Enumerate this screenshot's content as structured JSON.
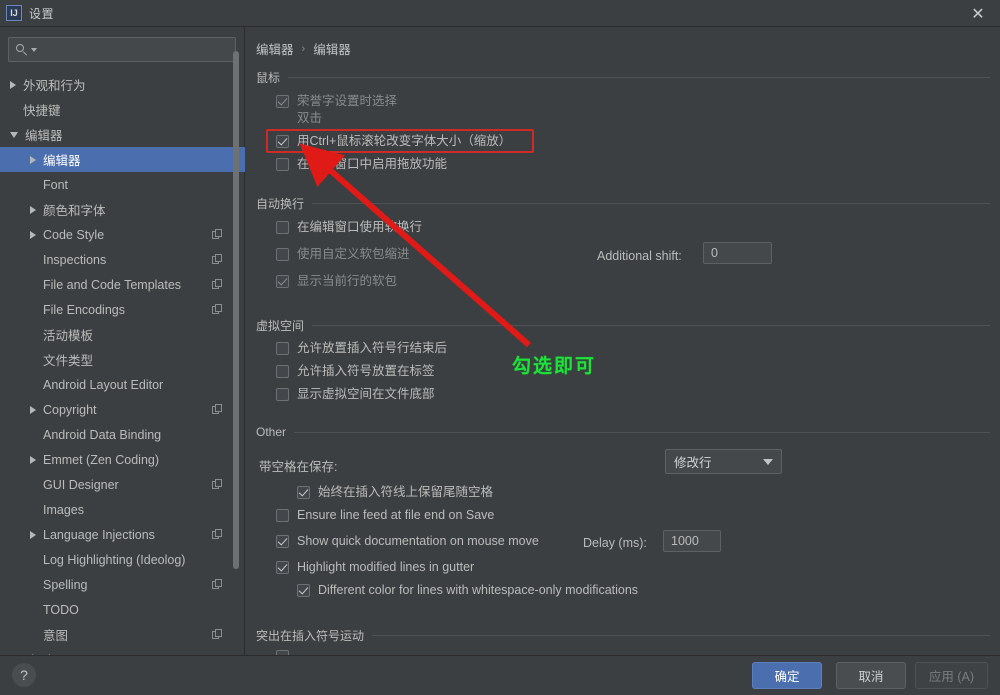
{
  "window": {
    "title": "设置",
    "app_icon": "intellij-idea-icon",
    "close_icon": "close-icon"
  },
  "sidebar": {
    "search": {
      "value": "",
      "placeholder": "",
      "icon": "search-icon",
      "caret_icon": "chevron-down-icon"
    },
    "items": [
      {
        "label": "外观和行为",
        "indent": 0,
        "arrow": "right",
        "badge": false,
        "selected": false
      },
      {
        "label": "快捷键",
        "indent": 0,
        "arrow": "none",
        "badge": false,
        "selected": false
      },
      {
        "label": "编辑器",
        "indent": 0,
        "arrow": "down",
        "badge": false,
        "selected": false
      },
      {
        "label": "编辑器",
        "indent": 1,
        "arrow": "right",
        "badge": false,
        "selected": true
      },
      {
        "label": "Font",
        "indent": 1,
        "arrow": "none",
        "badge": false,
        "selected": false
      },
      {
        "label": "颜色和字体",
        "indent": 1,
        "arrow": "right",
        "badge": false,
        "selected": false
      },
      {
        "label": "Code Style",
        "indent": 1,
        "arrow": "right",
        "badge": true,
        "selected": false
      },
      {
        "label": "Inspections",
        "indent": 1,
        "arrow": "none",
        "badge": true,
        "selected": false
      },
      {
        "label": "File and Code Templates",
        "indent": 1,
        "arrow": "none",
        "badge": true,
        "selected": false
      },
      {
        "label": "File Encodings",
        "indent": 1,
        "arrow": "none",
        "badge": true,
        "selected": false
      },
      {
        "label": "活动模板",
        "indent": 1,
        "arrow": "none",
        "badge": false,
        "selected": false
      },
      {
        "label": "文件类型",
        "indent": 1,
        "arrow": "none",
        "badge": false,
        "selected": false
      },
      {
        "label": "Android Layout Editor",
        "indent": 1,
        "arrow": "none",
        "badge": false,
        "selected": false
      },
      {
        "label": "Copyright",
        "indent": 1,
        "arrow": "right",
        "badge": true,
        "selected": false
      },
      {
        "label": "Android Data Binding",
        "indent": 1,
        "arrow": "none",
        "badge": false,
        "selected": false
      },
      {
        "label": "Emmet (Zen Coding)",
        "indent": 1,
        "arrow": "right",
        "badge": false,
        "selected": false
      },
      {
        "label": "GUI Designer",
        "indent": 1,
        "arrow": "none",
        "badge": true,
        "selected": false
      },
      {
        "label": "Images",
        "indent": 1,
        "arrow": "none",
        "badge": false,
        "selected": false
      },
      {
        "label": "Language Injections",
        "indent": 1,
        "arrow": "right",
        "badge": true,
        "selected": false
      },
      {
        "label": "Log Highlighting (Ideolog)",
        "indent": 1,
        "arrow": "none",
        "badge": false,
        "selected": false
      },
      {
        "label": "Spelling",
        "indent": 1,
        "arrow": "none",
        "badge": true,
        "selected": false
      },
      {
        "label": "TODO",
        "indent": 1,
        "arrow": "none",
        "badge": false,
        "selected": false
      },
      {
        "label": "意图",
        "indent": 1,
        "arrow": "none",
        "badge": true,
        "selected": false
      },
      {
        "label": "Plugins",
        "indent": 0,
        "arrow": "none",
        "badge": false,
        "selected": false
      }
    ]
  },
  "main": {
    "breadcrumb": {
      "root": "编辑器",
      "separator": "›",
      "leaf": "编辑器"
    },
    "groups": {
      "mouse": "鼠标",
      "wordwrap": "自动换行",
      "virtualspace": "虚拟空间",
      "other": "Other",
      "caret": "突出在插入符号运动"
    },
    "mouse_options": [
      {
        "label": "荣誉字设置时选择",
        "checked": true,
        "enabled": false
      },
      {
        "label": "双击",
        "checked": null,
        "enabled": false
      },
      {
        "label": "用Ctrl+鼠标滚轮改变字体大小（缩放）",
        "checked": true,
        "enabled": true
      },
      {
        "label": "在编辑窗口中启用拖放功能",
        "checked": false,
        "enabled": true
      }
    ],
    "wordwrap_options": [
      {
        "label": "在编辑窗口使用软换行",
        "checked": false,
        "enabled": true
      },
      {
        "label": "使用自定义软包缩进",
        "checked": false,
        "enabled": false
      },
      {
        "label": "显示当前行的软包",
        "checked": true,
        "enabled": false
      }
    ],
    "additional_shift": {
      "label": "Additional shift:",
      "value": "0"
    },
    "virtualspace_options": [
      {
        "label": "允许放置插入符号行结束后",
        "checked": false,
        "enabled": true
      },
      {
        "label": "允许插入符号放置在标签",
        "checked": false,
        "enabled": true
      },
      {
        "label": "显示虚拟空间在文件底部",
        "checked": false,
        "enabled": true
      }
    ],
    "strip_spaces": {
      "label": "带空格在保存:",
      "value": "修改行",
      "arrow_icon": "chevron-down-icon"
    },
    "other_options": [
      {
        "label": "始终在插入符线上保留尾随空格",
        "checked": true,
        "enabled": true,
        "indent": 1
      },
      {
        "label": "Ensure line feed at file end on Save",
        "checked": false,
        "enabled": true,
        "indent": 0
      },
      {
        "label": "Show quick documentation on mouse move",
        "checked": true,
        "enabled": true,
        "indent": 0
      },
      {
        "label": "Highlight modified lines in gutter",
        "checked": true,
        "enabled": true,
        "indent": 0
      },
      {
        "label": "Different color for lines with whitespace-only modifications",
        "checked": true,
        "enabled": true,
        "indent": 1
      }
    ],
    "delay": {
      "label": "Delay (ms):",
      "value": "1000"
    }
  },
  "annotations": {
    "highlight_box": "red-rectangle-highlight",
    "arrow": "red-arrow",
    "note_text": "勾选即可",
    "colors": {
      "red": "#d02a27",
      "green": "#1fe03c"
    }
  },
  "footer": {
    "help_label": "?",
    "ok": "确定",
    "cancel": "取消",
    "apply": "应用 (A)"
  }
}
